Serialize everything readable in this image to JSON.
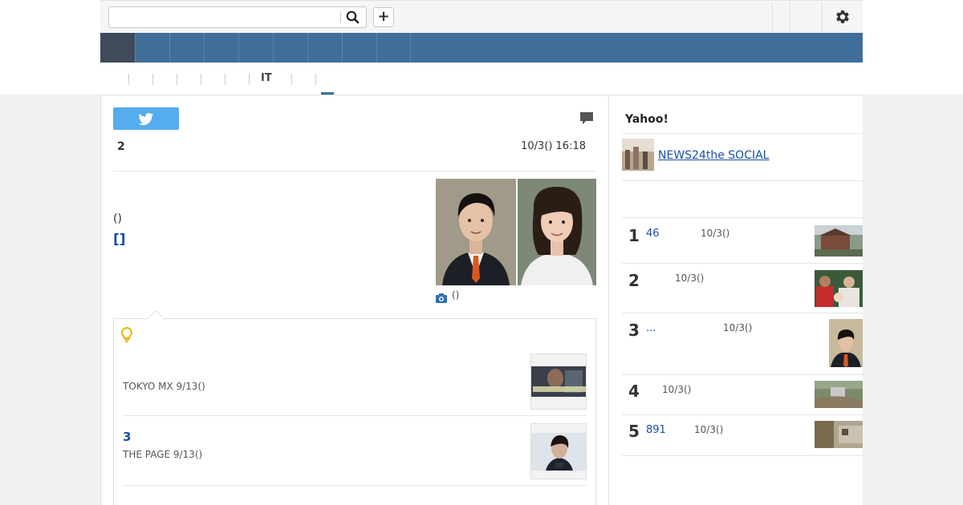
{
  "header": {
    "search": {
      "value": "",
      "placeholder": "",
      "icon": "search-icon"
    },
    "add_icon": "plus-icon",
    "add_label": "+",
    "settings_icon": "gear-icon"
  },
  "nav": {
    "home_label": "",
    "items": [
      "",
      "",
      "",
      "",
      "",
      "",
      "",
      ""
    ]
  },
  "subnav": {
    "items": [
      "",
      "",
      "",
      "",
      "",
      "IT",
      "",
      ""
    ],
    "it_label": "IT"
  },
  "article": {
    "share_icon": "twitter-icon",
    "comment_icon": "comment-icon",
    "number": "2",
    "date": "10/3() 16:18",
    "source": "()",
    "headline": "[]",
    "photo_caption": "()"
  },
  "related": {
    "icon": "lightbulb-icon",
    "items": [
      {
        "title": "",
        "meta": "TOKYO MX 9/13()"
      },
      {
        "title": "3",
        "meta": "THE PAGE 9/13()"
      }
    ]
  },
  "sidebar": {
    "title": "Yahoo!",
    "promo": {
      "label": "NEWS24the SOCIAL"
    },
    "ranking": [
      {
        "rank": "1",
        "title": "46",
        "date": "10/3()"
      },
      {
        "rank": "2",
        "title": "",
        "date": "10/3()"
      },
      {
        "rank": "3",
        "title": "...",
        "date": "10/3()"
      },
      {
        "rank": "4",
        "title": "",
        "date": "10/3()"
      },
      {
        "rank": "5",
        "title": "891",
        "date": "10/3()"
      }
    ]
  },
  "colors": {
    "nav_blue": "#3f6e99",
    "nav_dark": "#3f4a5a",
    "link_blue": "#1a4fa8",
    "twitter": "#55acee",
    "accent_yellow": "#e8b200"
  }
}
